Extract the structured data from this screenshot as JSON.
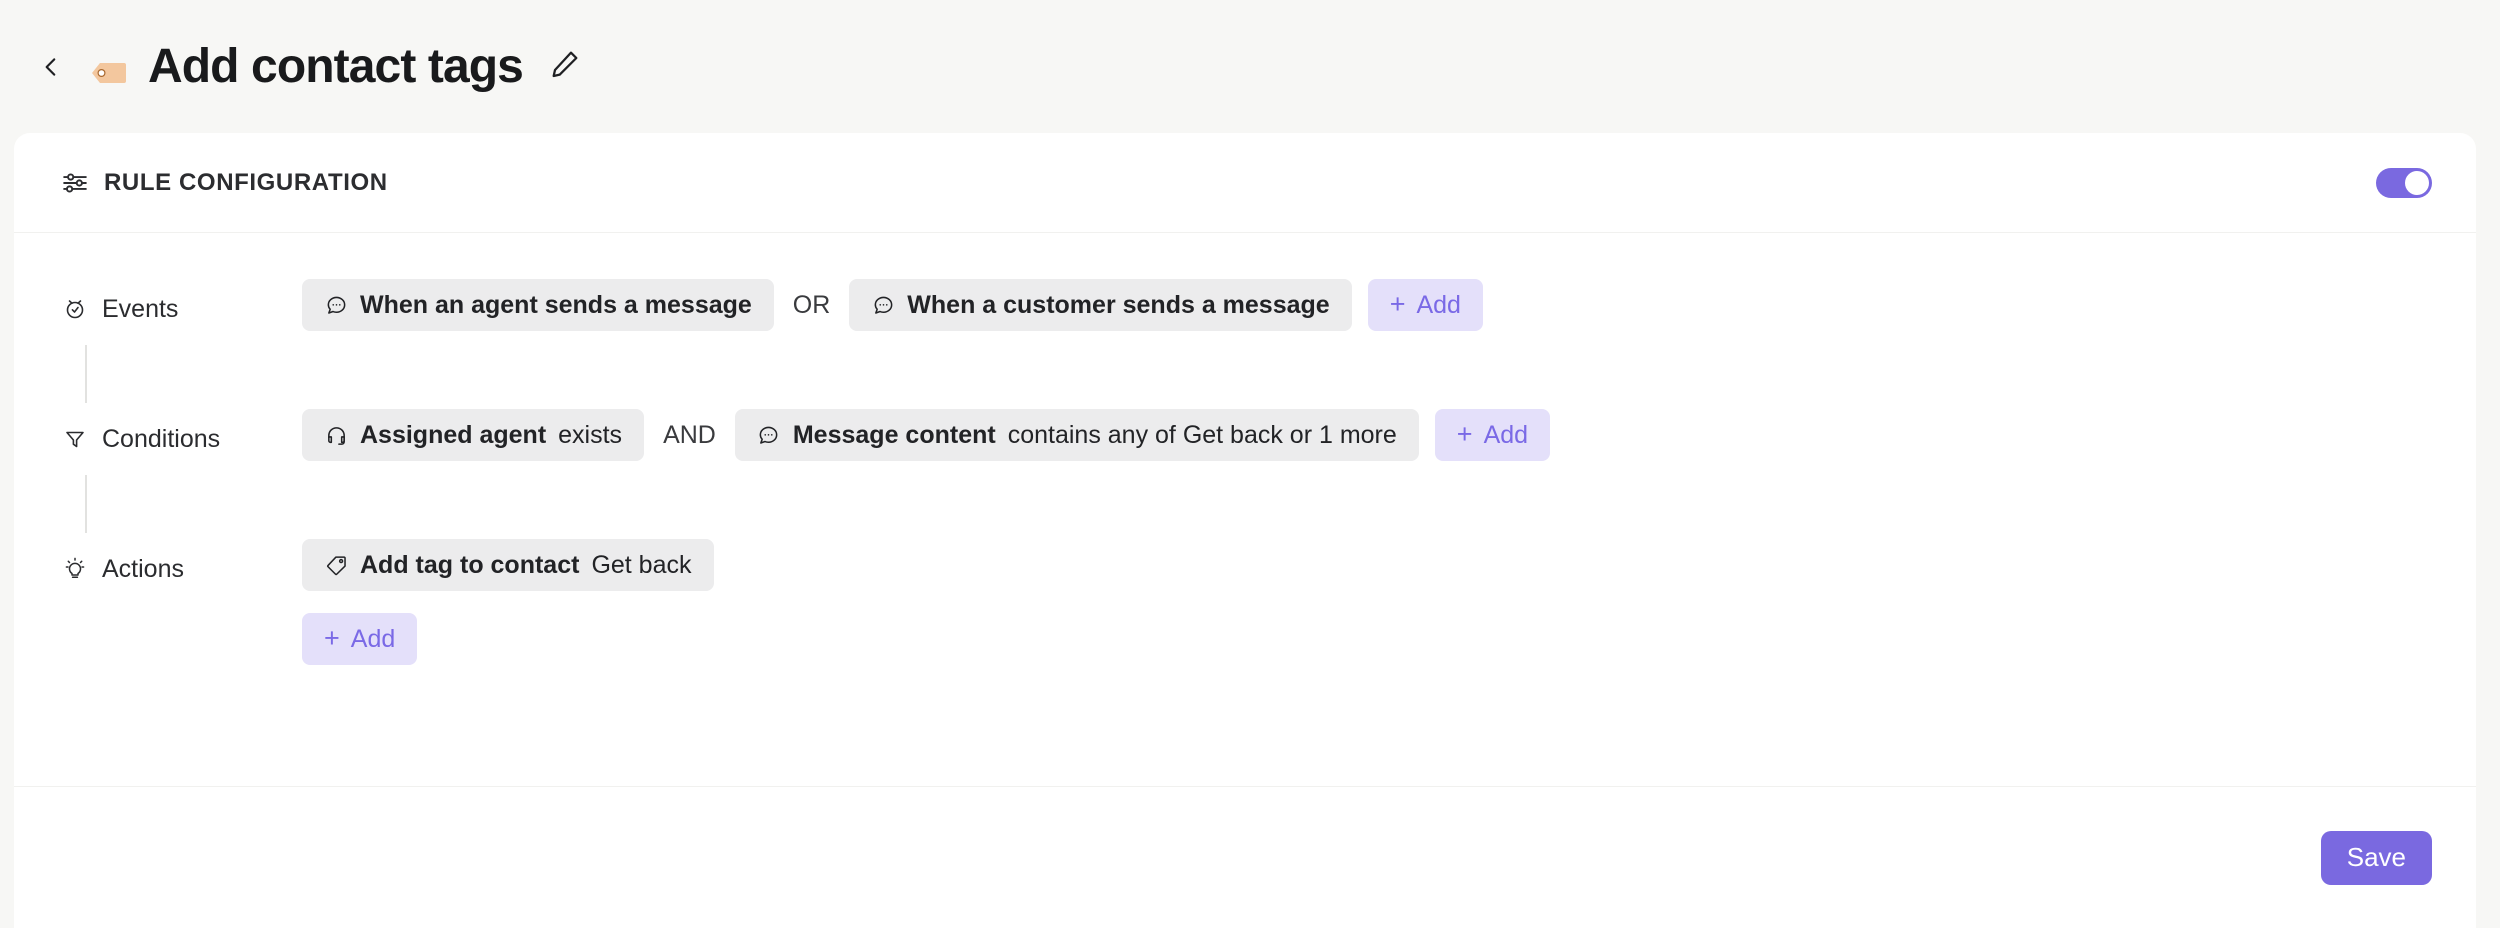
{
  "header": {
    "back_icon": "chevron-left-icon",
    "tag_icon": "tag-emoji-icon",
    "title": "Add contact tags",
    "edit_icon": "pencil-icon"
  },
  "card": {
    "section_icon": "sliders-icon",
    "section_title": "RULE CONFIGURATION",
    "enabled_toggle": {
      "name": "rule-enabled-toggle",
      "state": "on"
    },
    "rows": [
      {
        "id": "events",
        "icon": "alarm-clock-icon",
        "label": "Events",
        "items": [
          {
            "icon": "speech-bubble-icon",
            "strong": "When an agent sends a message",
            "rest": ""
          },
          {
            "icon": "speech-bubble-icon",
            "strong": "When a customer sends a message",
            "rest": ""
          }
        ],
        "joiner": "OR",
        "add_label": "Add",
        "add_plus": "+"
      },
      {
        "id": "conditions",
        "icon": "funnel-icon",
        "label": "Conditions",
        "items": [
          {
            "icon": "headset-icon",
            "strong": "Assigned agent",
            "rest": "exists"
          },
          {
            "icon": "speech-bubble-icon",
            "strong": "Message content",
            "rest": "contains any of Get back or 1 more"
          }
        ],
        "joiner": "AND",
        "add_label": "Add",
        "add_plus": "+"
      },
      {
        "id": "actions",
        "icon": "lightbulb-icon",
        "label": "Actions",
        "items": [
          {
            "icon": "tag-icon",
            "strong": "Add tag to contact",
            "rest": "Get back"
          }
        ],
        "joiner": "",
        "add_label": "Add",
        "add_plus": "+"
      }
    ],
    "footer": {
      "save_label": "Save"
    }
  },
  "colors": {
    "accent_purple": "#7a69e0",
    "add_button_bg": "#e4e0fa",
    "add_button_text": "#7a69e6",
    "chip_bg": "#ececed",
    "page_bg": "#f7f7f5",
    "tag_emoji": "#f3c499"
  }
}
